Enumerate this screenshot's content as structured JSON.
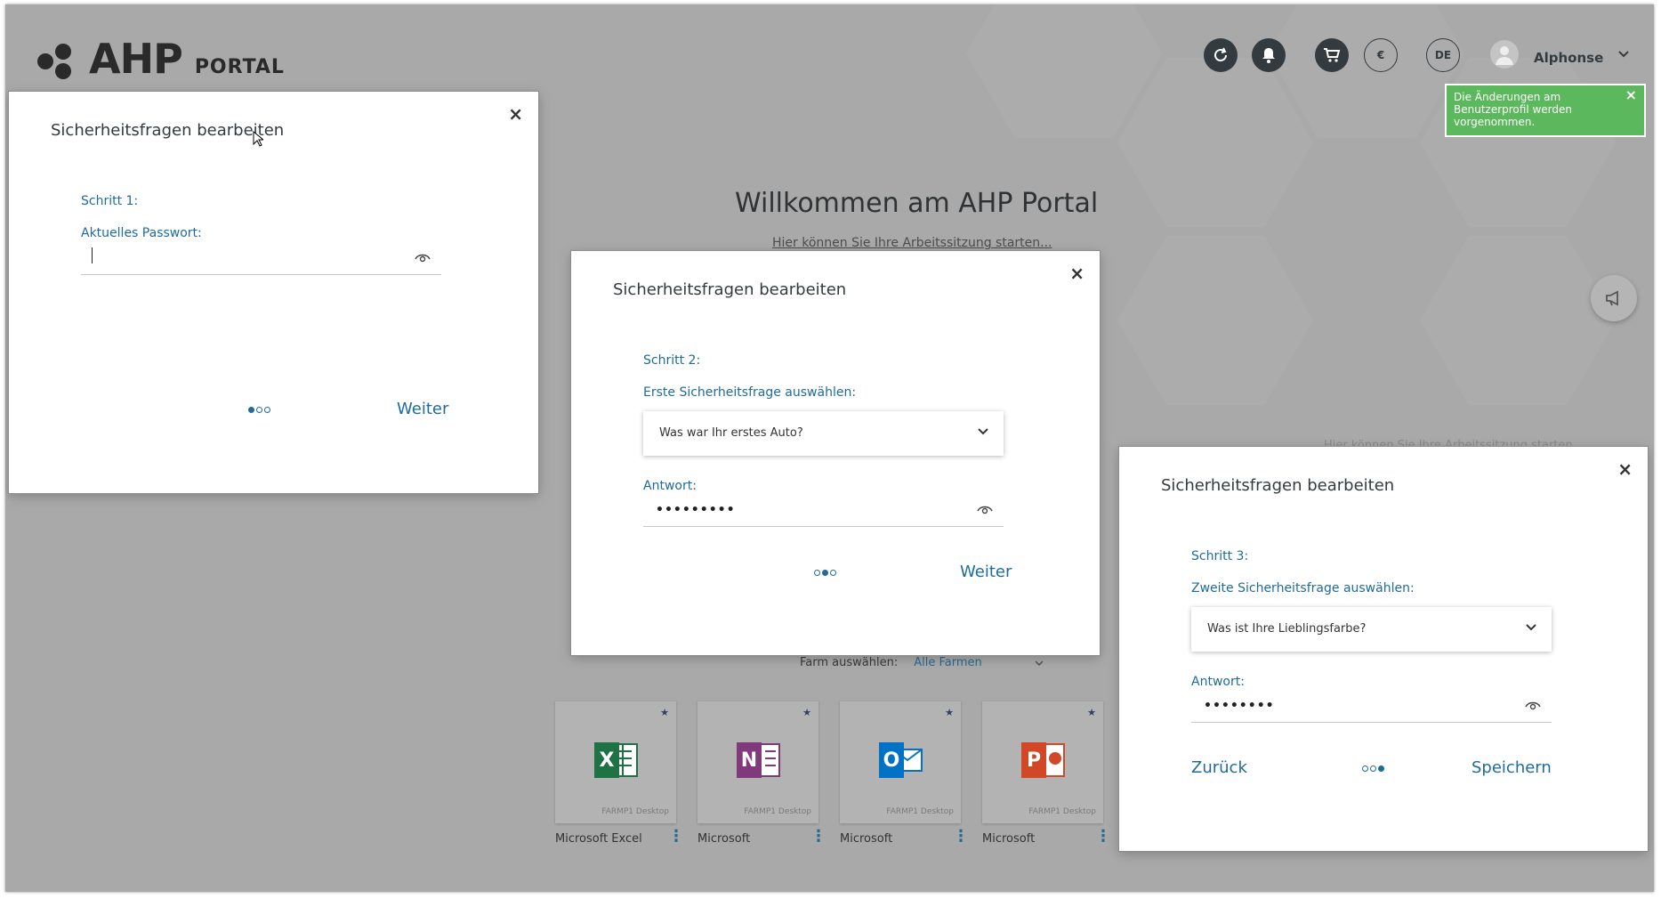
{
  "app": {
    "logo_main": "AHP",
    "logo_sub": "PORTAL"
  },
  "header": {
    "icons": [
      "refresh-icon",
      "bell-icon",
      "cart-icon",
      "currency-icon",
      "language-icon"
    ],
    "currency_label": "€",
    "language_label": "DE",
    "user_name": "Alphonse"
  },
  "toast": {
    "message": "Die Änderungen am Benutzerprofil werden vorgenommen.",
    "color": "#5cb85c"
  },
  "welcome": {
    "title": "Willkommen am AHP Portal",
    "subtitle": "Hier können Sie Ihre Arbeitssitzung starten...",
    "subtitle_repeat": "Hier können Sie Ihre Arbeitssitzung starten..."
  },
  "farm": {
    "label": "Farm auswählen:",
    "value": "Alle Farmen"
  },
  "apps": [
    {
      "name": "Microsoft Excel",
      "letter": "X",
      "sub": "FARMP1 Desktop",
      "color": "#1f7244"
    },
    {
      "name": "Microsoft",
      "letter": "N",
      "sub": "FARMP1 Desktop",
      "color": "#80397b"
    },
    {
      "name": "Microsoft",
      "letter": "O",
      "sub": "FARMP1 Desktop",
      "color": "#0072c6"
    },
    {
      "name": "Microsoft",
      "letter": "P",
      "sub": "FARMP1 Desktop",
      "color": "#d24726"
    }
  ],
  "dialogs": [
    {
      "title": "Sicherheitsfragen bearbeiten",
      "step": "Schritt 1:",
      "field_label": "Aktuelles Passwort:",
      "field_value": "",
      "next": "Weiter"
    },
    {
      "title": "Sicherheitsfragen bearbeiten",
      "step": "Schritt 2:",
      "select_label": "Erste Sicherheitsfrage auswählen:",
      "select_value": "Was war Ihr erstes Auto?",
      "answer_label": "Antwort:",
      "answer_value": "•••••••••",
      "next": "Weiter"
    },
    {
      "title": "Sicherheitsfragen bearbeiten",
      "step": "Schritt 3:",
      "select_label": "Zweite Sicherheitsfrage auswählen:",
      "select_value": "Was ist Ihre Lieblingsfarbe?",
      "answer_label": "Antwort:",
      "answer_value": "••••••••",
      "back": "Zurück",
      "save": "Speichern"
    }
  ],
  "colors": {
    "accent": "#1f6b9a",
    "overlay_bg": "#a9a9a9",
    "dark": "#333b40"
  }
}
